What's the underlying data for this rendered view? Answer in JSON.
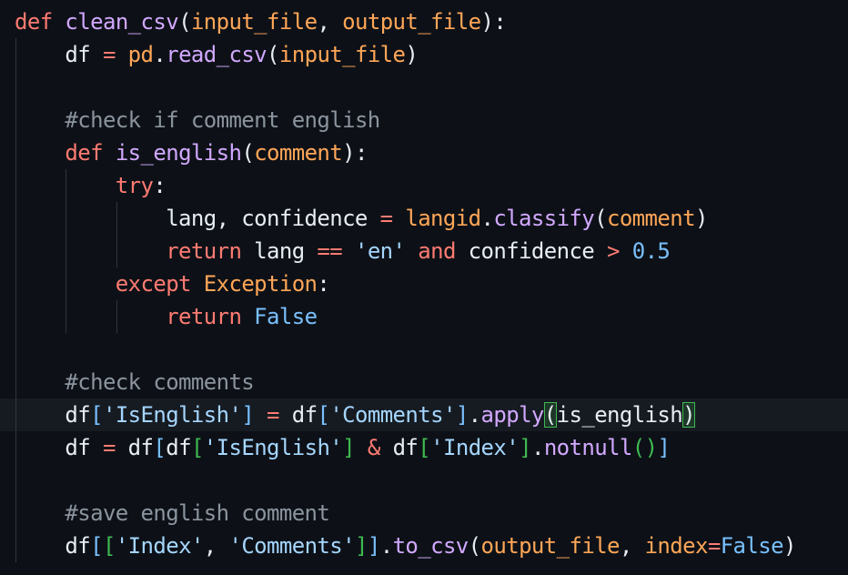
{
  "theme": {
    "background": "#0d1117",
    "current_line": "#161b22",
    "indent_guide": "#30363d",
    "bracket_match": "#3fb950",
    "tokens": {
      "kw": "#ff7b72",
      "fn": "#d2a8ff",
      "param": "#ffa657",
      "str": "#a5d6ff",
      "num": "#79c0ff",
      "cmt": "#8b949e",
      "op": "#ff7b72",
      "punc": "#e6edf3",
      "bracket": "#e6edf3",
      "bracket2": "#79c0ff",
      "bracket3": "#3fb950",
      "txt": "#e6edf3",
      "const": "#79c0ff",
      "cls": "#ffa657"
    }
  },
  "editor": {
    "current_line_index": 12,
    "lines": [
      [
        [
          "kw",
          "def"
        ],
        [
          "txt",
          " "
        ],
        [
          "fn",
          "clean_csv"
        ],
        [
          "bracket",
          "("
        ],
        [
          "param",
          "input_file"
        ],
        [
          "punc",
          ", "
        ],
        [
          "param",
          "output_file"
        ],
        [
          "bracket",
          ")"
        ],
        [
          "punc",
          ":"
        ]
      ],
      [
        [
          "txt",
          "    df "
        ],
        [
          "op",
          "="
        ],
        [
          "txt",
          " "
        ],
        [
          "param",
          "pd"
        ],
        [
          "punc",
          "."
        ],
        [
          "fn",
          "read_csv"
        ],
        [
          "bracket",
          "("
        ],
        [
          "param",
          "input_file"
        ],
        [
          "bracket",
          ")"
        ]
      ],
      [],
      [
        [
          "txt",
          "    "
        ],
        [
          "cmt",
          "#check if comment english"
        ]
      ],
      [
        [
          "txt",
          "    "
        ],
        [
          "kw",
          "def"
        ],
        [
          "txt",
          " "
        ],
        [
          "fn",
          "is_english"
        ],
        [
          "bracket",
          "("
        ],
        [
          "param",
          "comment"
        ],
        [
          "bracket",
          ")"
        ],
        [
          "punc",
          ":"
        ]
      ],
      [
        [
          "txt",
          "        "
        ],
        [
          "kw",
          "try"
        ],
        [
          "punc",
          ":"
        ]
      ],
      [
        [
          "txt",
          "            lang, confidence "
        ],
        [
          "op",
          "="
        ],
        [
          "txt",
          " "
        ],
        [
          "param",
          "langid"
        ],
        [
          "punc",
          "."
        ],
        [
          "fn",
          "classify"
        ],
        [
          "bracket",
          "("
        ],
        [
          "param",
          "comment"
        ],
        [
          "bracket",
          ")"
        ]
      ],
      [
        [
          "txt",
          "            "
        ],
        [
          "kw",
          "return"
        ],
        [
          "txt",
          " lang "
        ],
        [
          "op",
          "=="
        ],
        [
          "txt",
          " "
        ],
        [
          "str",
          "'en'"
        ],
        [
          "txt",
          " "
        ],
        [
          "kw",
          "and"
        ],
        [
          "txt",
          " confidence "
        ],
        [
          "op",
          ">"
        ],
        [
          "txt",
          " "
        ],
        [
          "num",
          "0.5"
        ]
      ],
      [
        [
          "txt",
          "        "
        ],
        [
          "kw",
          "except"
        ],
        [
          "txt",
          " "
        ],
        [
          "cls",
          "Exception"
        ],
        [
          "punc",
          ":"
        ]
      ],
      [
        [
          "txt",
          "            "
        ],
        [
          "kw",
          "return"
        ],
        [
          "txt",
          " "
        ],
        [
          "const",
          "False"
        ]
      ],
      [],
      [
        [
          "txt",
          "    "
        ],
        [
          "cmt",
          "#check comments"
        ]
      ],
      [
        [
          "txt",
          "    df"
        ],
        [
          "bracket2",
          "["
        ],
        [
          "str",
          "'IsEnglish'"
        ],
        [
          "bracket2",
          "]"
        ],
        [
          "txt",
          " "
        ],
        [
          "op",
          "="
        ],
        [
          "txt",
          " df"
        ],
        [
          "bracket2",
          "["
        ],
        [
          "str",
          "'Comments'"
        ],
        [
          "bracket2",
          "]"
        ],
        [
          "punc",
          "."
        ],
        [
          "fn",
          "apply"
        ],
        [
          "bm",
          "("
        ],
        [
          "txt",
          "is_english"
        ],
        [
          "bm",
          ")"
        ]
      ],
      [
        [
          "txt",
          "    df "
        ],
        [
          "op",
          "="
        ],
        [
          "txt",
          " df"
        ],
        [
          "bracket2",
          "["
        ],
        [
          "txt",
          "df"
        ],
        [
          "bracket3",
          "["
        ],
        [
          "str",
          "'IsEnglish'"
        ],
        [
          "bracket3",
          "]"
        ],
        [
          "txt",
          " "
        ],
        [
          "op",
          "&"
        ],
        [
          "txt",
          " df"
        ],
        [
          "bracket3",
          "["
        ],
        [
          "str",
          "'Index'"
        ],
        [
          "bracket3",
          "]"
        ],
        [
          "punc",
          "."
        ],
        [
          "fn",
          "notnull"
        ],
        [
          "bracket3",
          "()"
        ],
        [
          "bracket2",
          "]"
        ]
      ],
      [],
      [
        [
          "txt",
          "    "
        ],
        [
          "cmt",
          "#save english comment"
        ]
      ],
      [
        [
          "txt",
          "    df"
        ],
        [
          "bracket2",
          "["
        ],
        [
          "bracket3",
          "["
        ],
        [
          "str",
          "'Index'"
        ],
        [
          "punc",
          ", "
        ],
        [
          "str",
          "'Comments'"
        ],
        [
          "bracket3",
          "]"
        ],
        [
          "bracket2",
          "]"
        ],
        [
          "punc",
          "."
        ],
        [
          "fn",
          "to_csv"
        ],
        [
          "bracket",
          "("
        ],
        [
          "param",
          "output_file"
        ],
        [
          "punc",
          ", "
        ],
        [
          "param",
          "index"
        ],
        [
          "op",
          "="
        ],
        [
          "const",
          "False"
        ],
        [
          "bracket",
          ")"
        ]
      ]
    ]
  }
}
